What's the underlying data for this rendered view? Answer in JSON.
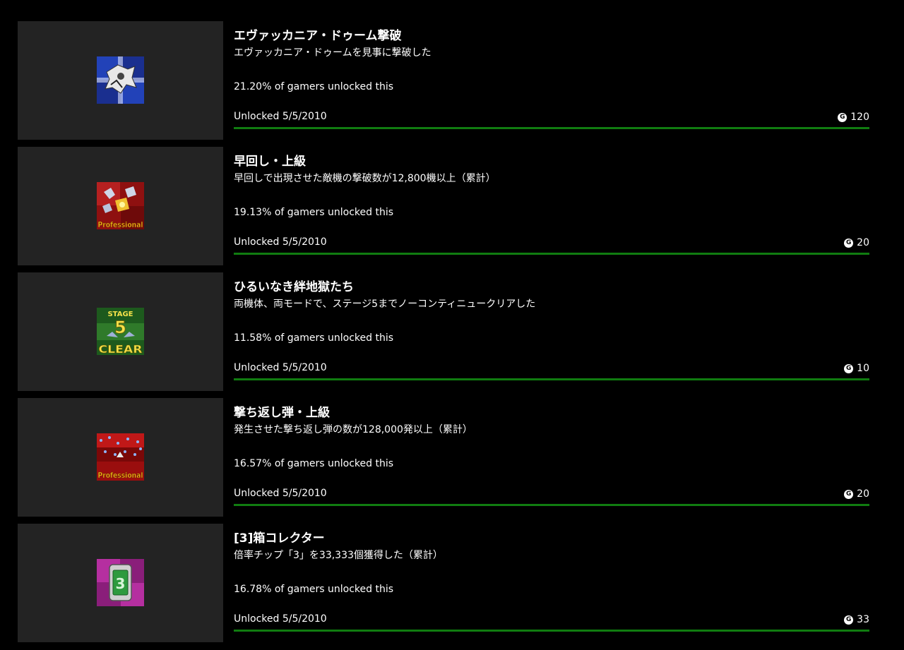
{
  "colors": {
    "progress": "#107c10",
    "tile_bg": "#232323",
    "page_bg": "#000000"
  },
  "gamerscore_icon_letter": "G",
  "achievements": [
    {
      "title": "エヴァッカニア・ドゥーム撃破",
      "description": "エヴァッカニア・ドゥームを見事に撃破した",
      "rarity": "21.20% of gamers unlocked this",
      "unlocked": "Unlocked 5/5/2010",
      "gamerscore": "120",
      "progress_fraction": 1.0,
      "icon": "boss-mech-icon",
      "icon_text": ""
    },
    {
      "title": "早回し・上級",
      "description": "早回しで出現させた敵機の撃破数が12,800機以上（累計）",
      "rarity": "19.13% of gamers unlocked this",
      "unlocked": "Unlocked 5/5/2010",
      "gamerscore": "20",
      "progress_fraction": 1.0,
      "icon": "professional-red-icon",
      "icon_text": "Professional"
    },
    {
      "title": "ひるいなき絆地獄たち",
      "description": "両機体、両モードで、ステージ5までノーコンティニュークリアした",
      "rarity": "11.58% of gamers unlocked this",
      "unlocked": "Unlocked 5/5/2010",
      "gamerscore": "10",
      "progress_fraction": 1.0,
      "icon": "stage-clear-icon",
      "icon_text": "STAGE",
      "icon_number": "5",
      "icon_text2": "CLEAR"
    },
    {
      "title": "撃ち返し弾・上級",
      "description": "発生させた撃ち返し弾の数が128,000発以上（累計）",
      "rarity": "16.57% of gamers unlocked this",
      "unlocked": "Unlocked 5/5/2010",
      "gamerscore": "20",
      "progress_fraction": 1.0,
      "icon": "professional-bullets-icon",
      "icon_text": "Professional"
    },
    {
      "title": "[3]箱コレクター",
      "description": "倍率チップ「3」を33,333個獲得した（累計）",
      "rarity": "16.78% of gamers unlocked this",
      "unlocked": "Unlocked 5/5/2010",
      "gamerscore": "33",
      "progress_fraction": 1.0,
      "icon": "chip-3-icon",
      "icon_text": "3"
    }
  ]
}
